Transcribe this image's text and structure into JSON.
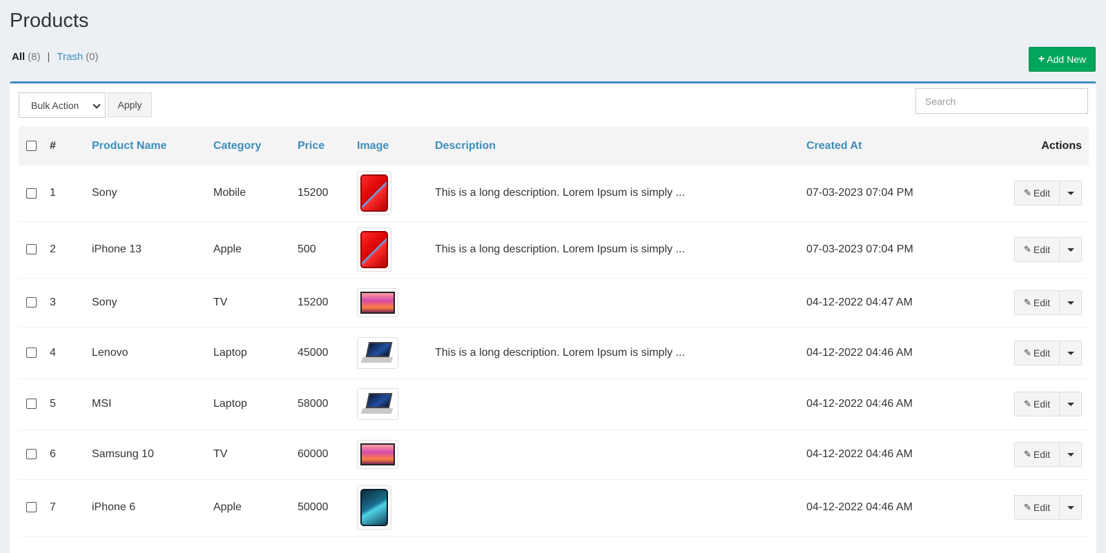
{
  "page": {
    "title": "Products"
  },
  "filters": {
    "all_label": "All",
    "all_count": "(8)",
    "separator": "|",
    "trash_label": "Trash",
    "trash_count": "(0)"
  },
  "toolbar": {
    "add_new_label": "Add New",
    "bulk_action_label": "Bulk Action",
    "apply_label": "Apply",
    "search_placeholder": "Search"
  },
  "table": {
    "headers": {
      "num": "#",
      "name": "Product Name",
      "category": "Category",
      "price": "Price",
      "image": "Image",
      "description": "Description",
      "created_at": "Created At",
      "actions": "Actions"
    },
    "edit_label": "Edit",
    "rows": [
      {
        "num": "1",
        "name": "Sony",
        "category": "Mobile",
        "price": "15200",
        "image": "phone-red",
        "description": "This is a long description. Lorem Ipsum is simply ...",
        "created_at": "07-03-2023 07:04 PM"
      },
      {
        "num": "2",
        "name": "iPhone 13",
        "category": "Apple",
        "price": "500",
        "image": "phone-red",
        "description": "This is a long description. Lorem Ipsum is simply ...",
        "created_at": "07-03-2023 07:04 PM"
      },
      {
        "num": "3",
        "name": "Sony",
        "category": "TV",
        "price": "15200",
        "image": "tv",
        "description": "",
        "created_at": "04-12-2022 04:47 AM"
      },
      {
        "num": "4",
        "name": "Lenovo",
        "category": "Laptop",
        "price": "45000",
        "image": "laptop",
        "description": "This is a long description. Lorem Ipsum is simply ...",
        "created_at": "04-12-2022 04:46 AM"
      },
      {
        "num": "5",
        "name": "MSI",
        "category": "Laptop",
        "price": "58000",
        "image": "laptop",
        "description": "",
        "created_at": "04-12-2022 04:46 AM"
      },
      {
        "num": "6",
        "name": "Samsung 10",
        "category": "TV",
        "price": "60000",
        "image": "tv",
        "description": "",
        "created_at": "04-12-2022 04:46 AM"
      },
      {
        "num": "7",
        "name": "iPhone 6",
        "category": "Apple",
        "price": "50000",
        "image": "phone-blue",
        "description": "",
        "created_at": "04-12-2022 04:46 AM"
      }
    ]
  },
  "colors": {
    "accent": "#3c8dbc",
    "add_button": "#00a65a",
    "background": "#ecf0f5"
  }
}
